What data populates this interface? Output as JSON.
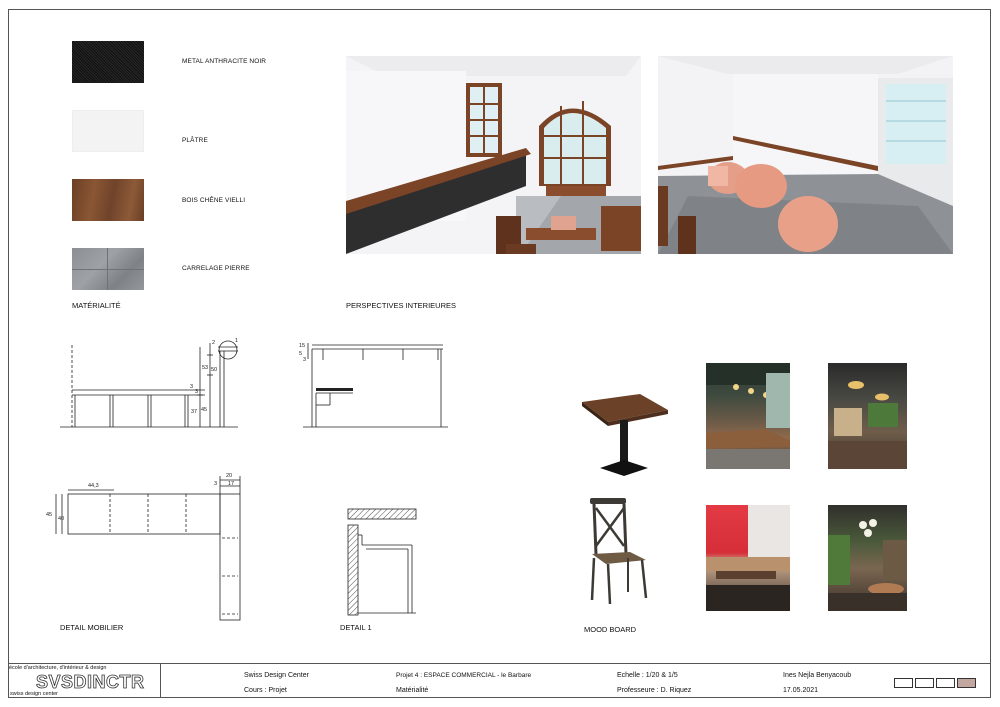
{
  "materials": {
    "items": [
      {
        "label": "METAL ANTHRACITE NOIR",
        "color": "#1a1a1a"
      },
      {
        "label": "PLÂTRE",
        "color": "#f2f2f2"
      },
      {
        "label": "BOIS CHÊNE VIELLI",
        "color": "#7a4a2e"
      },
      {
        "label": "CARRELAGE PIERRE",
        "color": "#8c8f93"
      }
    ],
    "section_title": "MATÉRIALITÉ"
  },
  "perspectives": {
    "section_title": "PERSPECTIVES INTERIEURES"
  },
  "drawings": {
    "detail_mobilier_title": "DETAIL MOBILIER",
    "detail1_title": "DETAIL 1",
    "callout": "1",
    "dims_elev1": [
      "2",
      "53",
      "50",
      "3",
      "3",
      "37",
      "45"
    ],
    "dims_elev2": [
      "15",
      "5",
      "3"
    ],
    "dims_plan": [
      "44,3",
      "45",
      "40",
      "20",
      "17",
      "3"
    ]
  },
  "moodboard": {
    "section_title": "MOOD BOARD"
  },
  "titleblock": {
    "school_line": "école d'architecture, d'intérieur & design",
    "logo": "SVSDINCTR",
    "logo_sub": "swiss design center",
    "institution": "Swiss Design Center",
    "course": "Cours : Projet",
    "project": "Projet 4 : ESPACE COMMERCIAL - le Barbare",
    "subject": "Matérialité",
    "scale": "Echelle : 1/20 & 1/5",
    "professor": "Professeure : D. Riquez",
    "author": "Ines Nejla Benyacoub",
    "date": "17.05.2021",
    "boxes_filled_color": "#c4a6a0"
  }
}
